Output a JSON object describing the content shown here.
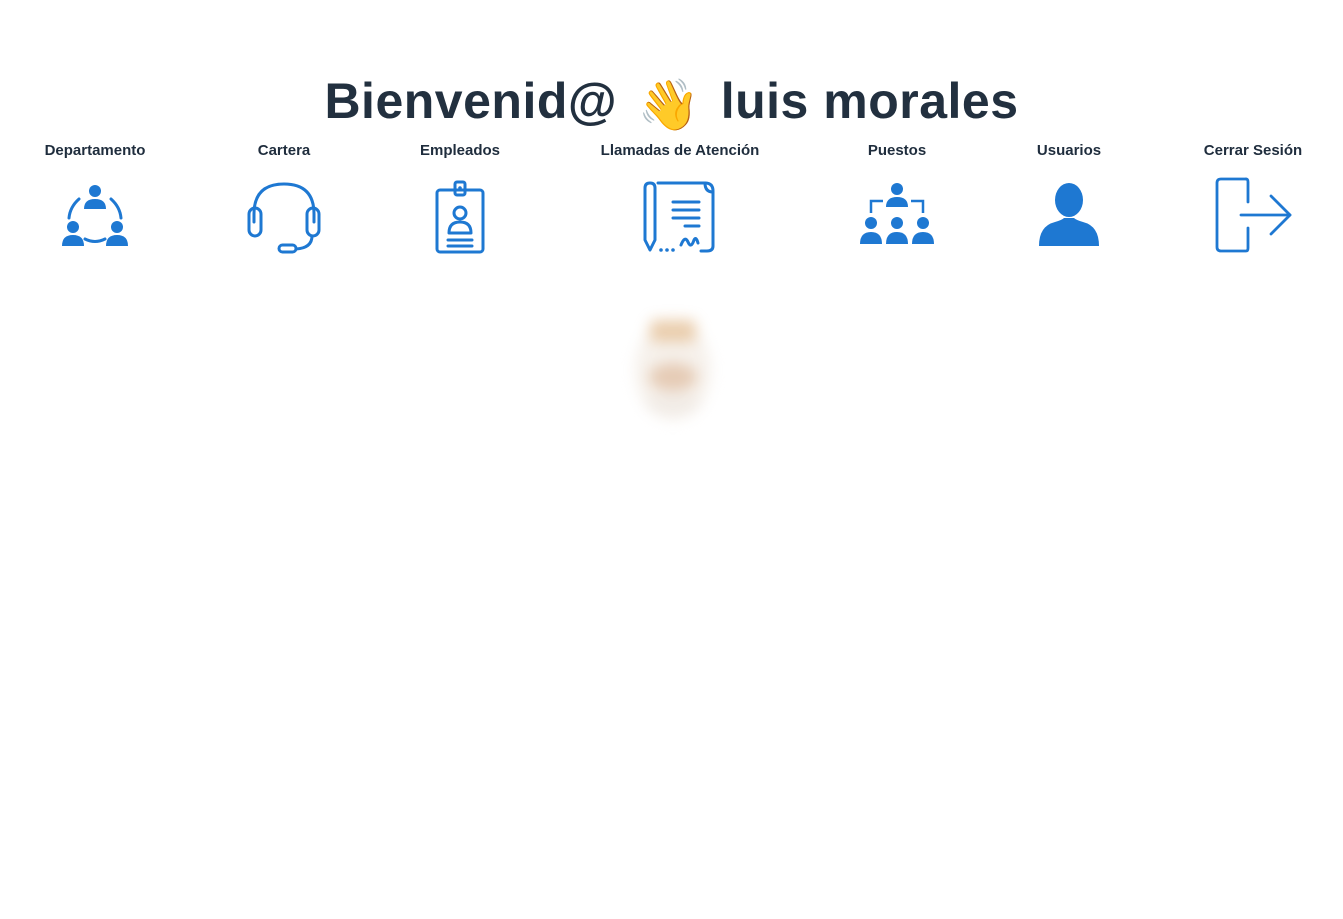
{
  "header": {
    "greeting": "Bienvenid@",
    "wave_emoji": "👋",
    "user_name": "luis morales"
  },
  "nav": {
    "departamento": "Departamento",
    "cartera": "Cartera",
    "empleados": "Empleados",
    "llamadas": "Llamadas de Atención",
    "puestos": "Puestos",
    "usuarios": "Usuarios",
    "cerrar_sesion": "Cerrar Sesión"
  },
  "icons": {
    "departamento": "team-cycle-icon",
    "cartera": "headset-icon",
    "empleados": "id-badge-icon",
    "llamadas": "contract-icon",
    "puestos": "org-chart-icon",
    "usuarios": "user-icon",
    "cerrar_sesion": "logout-icon"
  },
  "colors": {
    "icon_blue": "#1e78d2",
    "title_text": "#22303f"
  }
}
